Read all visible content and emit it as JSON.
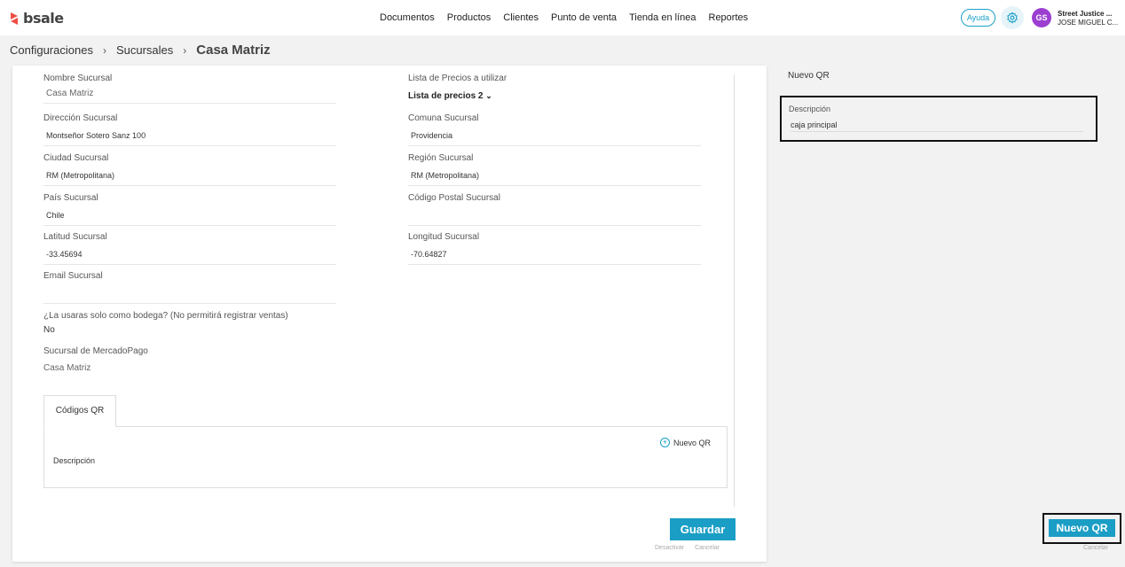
{
  "brand": {
    "name": "bsale",
    "accent": "#1a9ec5",
    "logo_color": "#f04e45"
  },
  "nav": {
    "items": [
      "Documentos",
      "Productos",
      "Clientes",
      "Punto de venta",
      "Tienda en línea",
      "Reportes"
    ]
  },
  "header": {
    "help_label": "Ayuda",
    "avatar_initials": "GS",
    "company": "Street Justice ...",
    "user": "JOSE MIGUEL C..."
  },
  "breadcrumb": {
    "level1": "Configuraciones",
    "level2": "Sucursales",
    "current": "Casa Matriz"
  },
  "form": {
    "nombre": {
      "label": "Nombre Sucursal",
      "value": "Casa Matriz"
    },
    "lista_precios": {
      "label": "Lista de Precios a utilizar",
      "value": "Lista de precios 2"
    },
    "direccion": {
      "label": "Dirección Sucursal",
      "value": "Montseñor Sotero Sanz 100"
    },
    "comuna": {
      "label": "Comuna Sucursal",
      "value": "Providencia"
    },
    "ciudad": {
      "label": "Ciudad Sucursal",
      "value": "RM (Metropolitana)"
    },
    "region": {
      "label": "Región Sucursal",
      "value": "RM (Metropolitana)"
    },
    "pais": {
      "label": "País Sucursal",
      "value": "Chile"
    },
    "codigo_postal": {
      "label": "Código Postal Sucursal",
      "value": ""
    },
    "latitud": {
      "label": "Latitud Sucursal",
      "value": "-33.45694"
    },
    "longitud": {
      "label": "Longitud Sucursal",
      "value": "-70.64827"
    },
    "email": {
      "label": "Email Sucursal",
      "value": ""
    },
    "bodega": {
      "label": "¿La usaras solo como bodega? (No permitirá registrar ventas)",
      "value": "No"
    },
    "mercadopago": {
      "label": "Sucursal de MercadoPago",
      "value": "Casa Matriz"
    }
  },
  "qr_section": {
    "tab_label": "Códigos QR",
    "new_link": "Nuevo QR",
    "column_description": "Descripción"
  },
  "actions": {
    "save": "Guardar",
    "deactivate": "Desactivar",
    "cancel": "Cancelar"
  },
  "side_panel": {
    "title": "Nuevo QR",
    "description_label": "Descripción",
    "description_value": "caja principal",
    "submit": "Nuevo QR",
    "cancel": "Cancelar"
  }
}
